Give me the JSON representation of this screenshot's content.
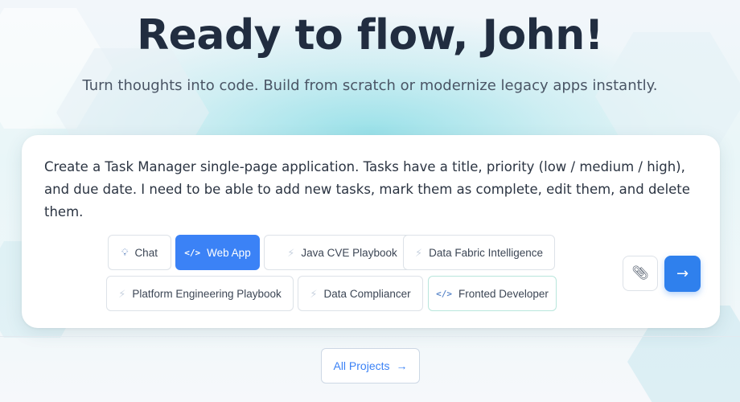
{
  "hero": {
    "title": "Ready to flow, John!",
    "subtitle": "Turn thoughts into code. Build from scratch or modernize legacy apps instantly."
  },
  "prompt": {
    "text": "Create a Task Manager single-page application. Tasks have a title, priority (low / medium / high), and due date. I need to be able to add new tasks, mark them as complete, edit them, and delete them."
  },
  "modes": [
    {
      "label": "Chat",
      "icon": "lightbulb-icon",
      "selected": false
    },
    {
      "label": "Web App",
      "icon": "code-icon",
      "selected": true
    },
    {
      "label": "Java CVE Playbook",
      "icon": "bolt-icon",
      "selected": false
    },
    {
      "label": "Data Fabric Intelligence",
      "icon": "bolt-icon",
      "selected": false
    },
    {
      "label": "Platform Engineering Playbook",
      "icon": "bolt-icon",
      "selected": false
    },
    {
      "label": "Data Compliancer",
      "icon": "bolt-icon",
      "selected": false
    },
    {
      "label": "Fronted Developer",
      "icon": "code-icon",
      "selected": false
    }
  ],
  "actions": {
    "attach_icon": "paperclip-icon",
    "send_icon": "arrow-right-icon"
  },
  "footer": {
    "all_projects_label": "All Projects"
  },
  "colors": {
    "accent": "#3b82f6",
    "title": "#212d40"
  }
}
